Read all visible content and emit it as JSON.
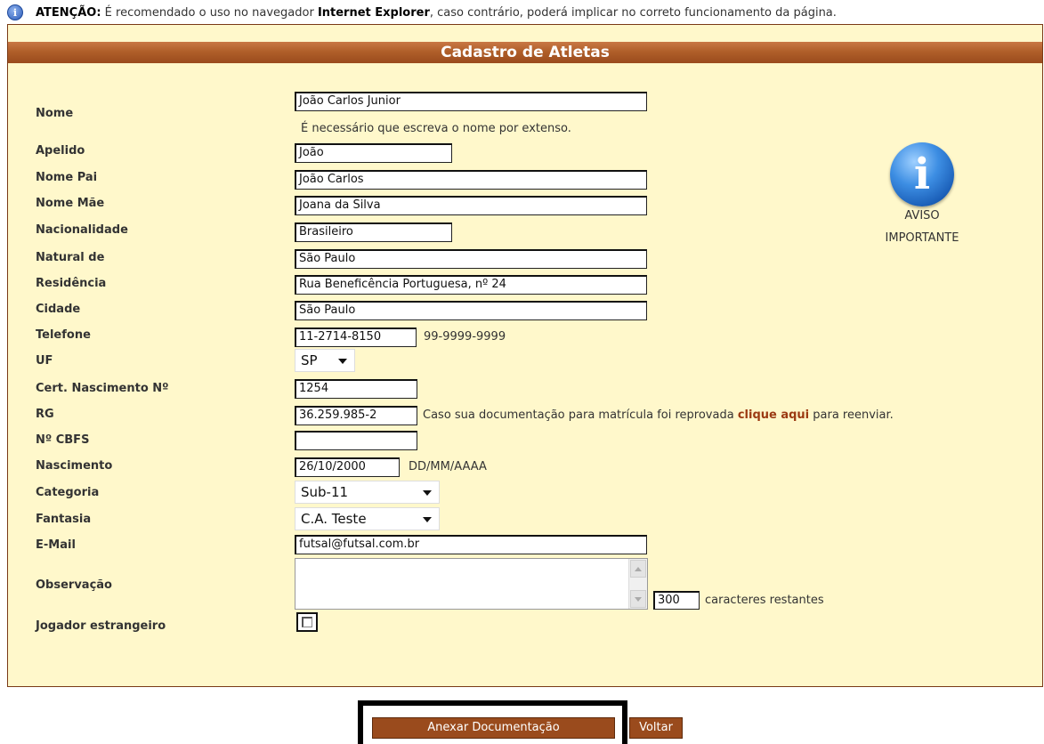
{
  "warning": {
    "prefix": "ATENÇÃO:",
    "text1": " É recomendado o uso no navegador ",
    "browser": "Internet Explorer",
    "text2": ", caso contrário, poderá implicar no correto funcionamento da página."
  },
  "panel_title": "Cadastro de Atletas",
  "form": {
    "nome": {
      "label": "Nome",
      "value": "João Carlos Junior",
      "hint": "É necessário que escreva o nome por extenso."
    },
    "apelido": {
      "label": "Apelido",
      "value": "João"
    },
    "nome_pai": {
      "label": "Nome Pai",
      "value": "João Carlos"
    },
    "nome_mae": {
      "label": "Nome Mãe",
      "value": "Joana da Silva"
    },
    "nacionalidade": {
      "label": "Nacionalidade",
      "value": "Brasileiro"
    },
    "natural_de": {
      "label": "Natural de",
      "value": "São Paulo"
    },
    "residencia": {
      "label": "Residência",
      "value": "Rua Beneficência Portuguesa, nº 24"
    },
    "cidade": {
      "label": "Cidade",
      "value": "São Paulo"
    },
    "telefone": {
      "label": "Telefone",
      "value": "11-2714-8150",
      "hint": "99-9999-9999"
    },
    "uf": {
      "label": "UF",
      "value": "SP"
    },
    "cert_nascimento": {
      "label": "Cert. Nascimento Nº",
      "value": "1254"
    },
    "rg": {
      "label": "RG",
      "value": "36.259.985-2",
      "hint_before": "Caso sua documentação para matrícula foi reprovada ",
      "hint_link": "clique aqui",
      "hint_after": " para reenviar."
    },
    "cbfs": {
      "label": "Nº CBFS",
      "value": ""
    },
    "nascimento": {
      "label": "Nascimento",
      "value": "26/10/2000",
      "hint": "DD/MM/AAAA"
    },
    "categoria": {
      "label": "Categoria",
      "value": "Sub-11"
    },
    "fantasia": {
      "label": "Fantasia",
      "value": "C.A. Teste"
    },
    "email": {
      "label": "E-Mail",
      "value": "futsal@futsal.com.br"
    },
    "observacao": {
      "label": "Observação",
      "counter": "300",
      "counter_label": "caracteres restantes"
    },
    "estrangeiro": {
      "label": "Jogador estrangeiro",
      "checked": false
    }
  },
  "aviso": {
    "icon": "info-icon",
    "line1": "AVISO",
    "line2": "IMPORTANTE"
  },
  "buttons": {
    "anexar": "Anexar Documentação",
    "voltar": "Voltar"
  },
  "colors": {
    "panel_bg": "#fff8cb",
    "header": "#9a4b1d",
    "accent": "#9b3a12"
  }
}
